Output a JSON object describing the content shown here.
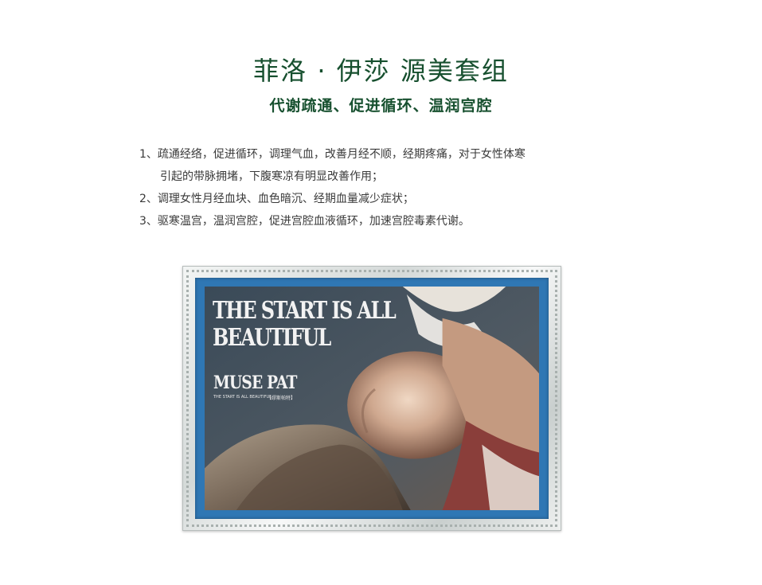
{
  "header": {
    "title": "菲洛 · 伊莎  源美套组",
    "subtitle": "代谢疏通、促进循环、温润宫腔"
  },
  "description": {
    "items": [
      "1、疏通经络，促进循环，调理气血，改善月经不顺，经期疼痛，对于女性体寒",
      "引起的带脉拥堵，下腹寒凉有明显改善作用；",
      "2、调理女性月经血块、血色暗沉、经期血量减少症状；",
      "3、驱寒温宫，温润宫腔，促进宫腔血液循环，加速宫腔毒素代谢。"
    ]
  },
  "product_image": {
    "headline_line1": "THE START IS ALL",
    "headline_line2": "BEAUTIFUL",
    "brand": "MUSE PAT",
    "tagline": "THE START IS ALL BEAUTIFUL",
    "tagline_cn": "【缪斯帕特】",
    "colors": {
      "frame": "#d9dedd",
      "mat": "#2f77b4",
      "title_green": "#17502f"
    }
  }
}
